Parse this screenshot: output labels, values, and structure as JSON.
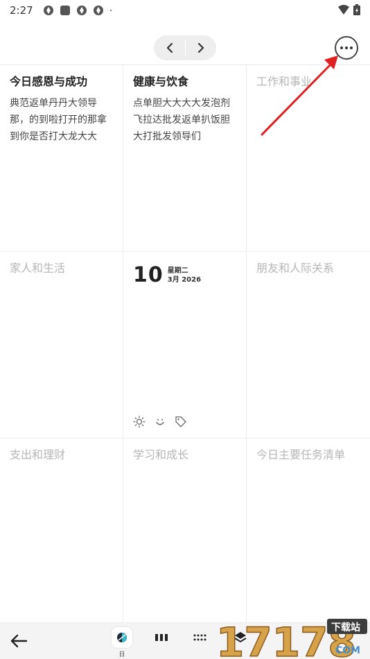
{
  "status_bar": {
    "time": "2:27"
  },
  "grid": {
    "cells": [
      {
        "title": "今日感恩与成功",
        "body": "典范返单丹丹大领导那，的到啦打开的那拿到你是否打大龙大大",
        "empty": false
      },
      {
        "title": "健康与饮食",
        "body": "点单胆大大大大发泡剂飞拉达批发返单扒饭胆大打批发领导们",
        "empty": false
      },
      {
        "title": "工作和事业",
        "body": "",
        "empty": true
      },
      {
        "title": "家人和生活",
        "body": "",
        "empty": true
      },
      {
        "center": true
      },
      {
        "title": "朋友和人际关系",
        "body": "",
        "empty": true
      },
      {
        "title": "支出和理财",
        "body": "",
        "empty": true
      },
      {
        "title": "学习和成长",
        "body": "",
        "empty": true
      },
      {
        "title": "今日主要任务清单",
        "body": "",
        "empty": true
      }
    ]
  },
  "date_block": {
    "day": "10",
    "weekday": "星期二",
    "month_year": "3月 2026"
  },
  "center_icons": [
    "sun-icon",
    "smile-icon",
    "tag-icon"
  ],
  "bottom_nav": {
    "active_view_label": "日"
  },
  "watermark": {
    "text": "17178",
    "sub": "下载站",
    "domain": "COM"
  },
  "colors": {
    "annotation_arrow": "#e02020",
    "empty_title": "#b6b6b6",
    "nav_pill": "#eeeeee"
  }
}
